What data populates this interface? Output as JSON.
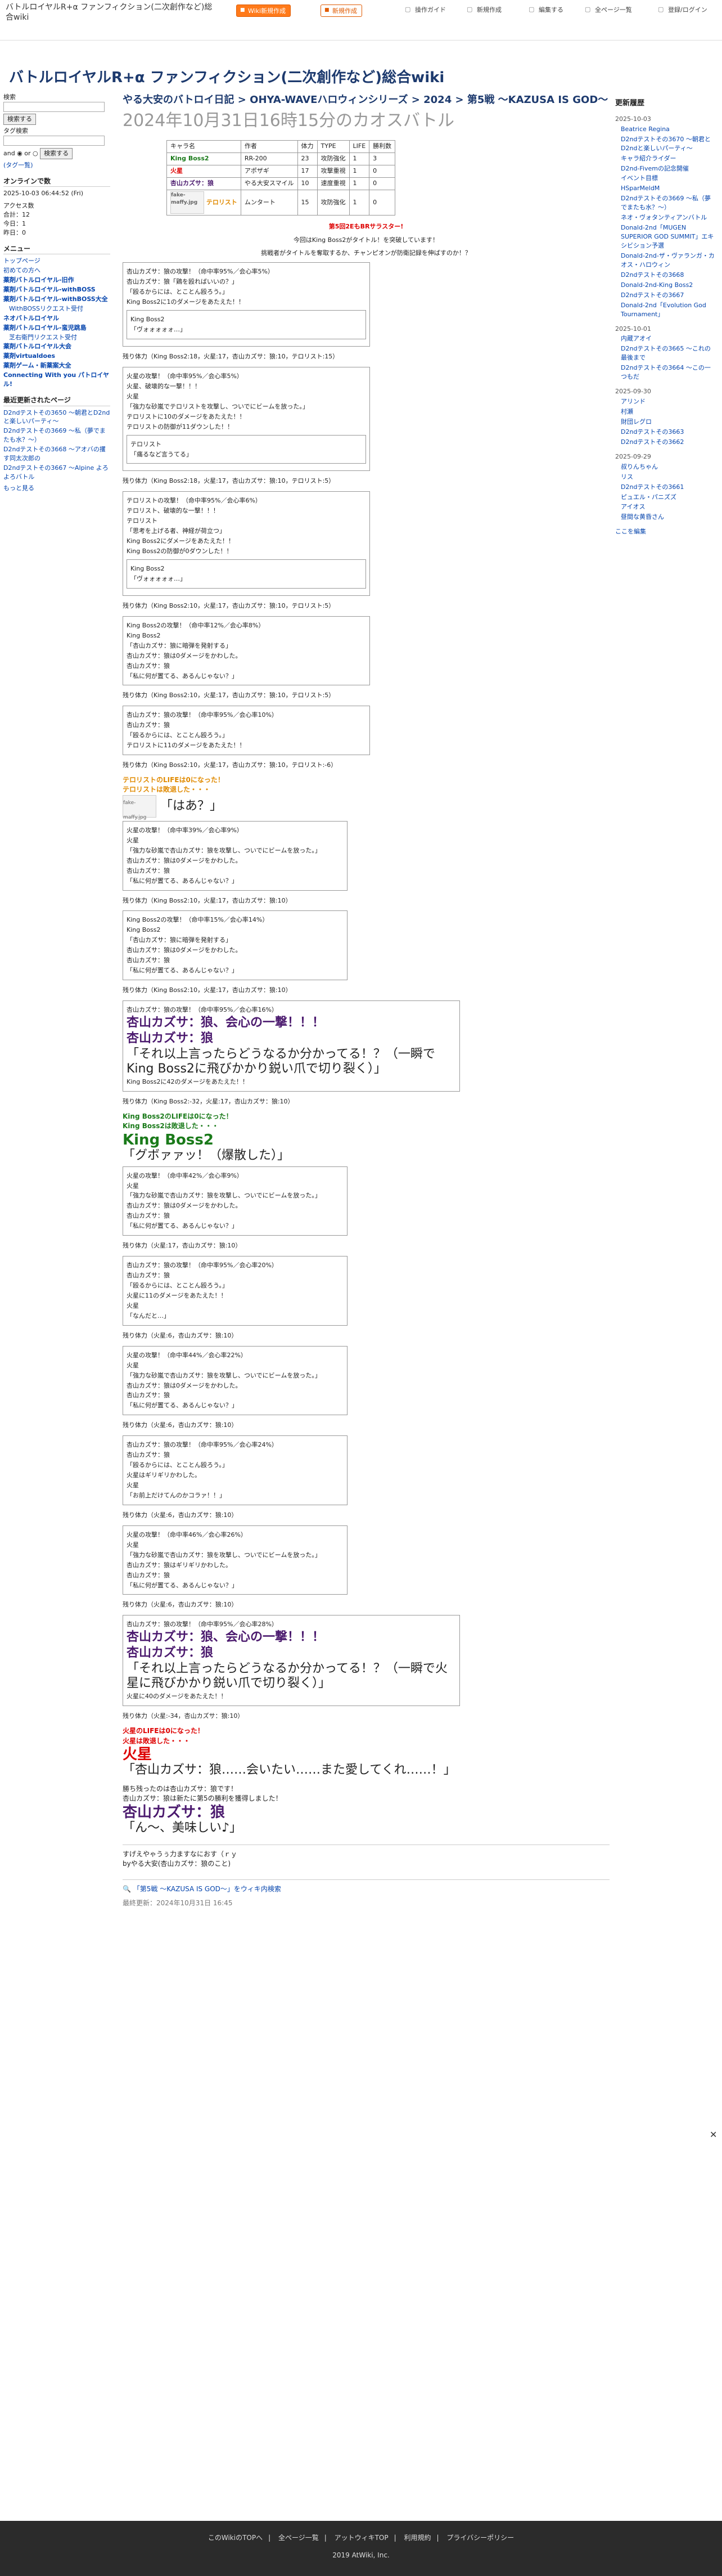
{
  "topbar": {
    "site_title": "バトルロイヤルR+α ファンフィクション(二次創作など)総合wiki",
    "btn_wiki": "Wiki新規作成",
    "btn_new_page": "新規作成",
    "btn_operations": "操作ガイド",
    "btn_new": "新規作成",
    "btn_edit": "編集する",
    "btn_all_pages": "全ページ一覧",
    "btn_login": "登録/ログイン"
  },
  "header": {
    "wiki_title": "バトルロイヤルR+α ファンフィクション(二次創作など)総合wiki"
  },
  "left": {
    "search_label": "検索",
    "search_button": "検索する",
    "tag_search_label": "タグ検索",
    "and_label": "and",
    "or_label": "or",
    "tag_search_button": "検索する",
    "tag_list_link": "(タグ一覧)",
    "online_label": "オンラインで数",
    "updated": "2025-10-03 06:44:52 (Fri)",
    "access_label": "アクセス数",
    "access_total": "合計：12",
    "access_today": "今日：1",
    "access_yesterday": "昨日：0",
    "menu_title": "メニュー",
    "menu": [
      "トップページ",
      "初めての方へ",
      "薬剤バトルロイヤル-旧作",
      "薬剤バトルロイヤル-withBOSS",
      "薬剤バトルロイヤル-withBOSS大全",
      "WithBOSSリクエスト受付",
      "ネオバトルロイヤル",
      "薬剤バトルロイヤル-蛮児跳島",
      "芝右衛門リクエスト受付",
      "薬剤バトルロイヤル大会",
      "薬剤virtualdoes",
      "薬剤ゲーム・新薬案大全",
      "Connecting With you パトロイヤル!"
    ],
    "recent_title": "最近更新されたページ",
    "recent": [
      "D2ndテストその3650 〜朝君とD2ndと楽しいパーティ〜",
      "D2ndテストその3669 〜私（夢でまたも水？〜）",
      "D2ndテストその3668 〜アオバの攫す同太次郎の",
      "D2ndテストその3667 〜Alpine よろよろバトル"
    ],
    "more_link": "もっと見る"
  },
  "main": {
    "breadcrumb": "やる大安のバトロイ日記 > OHYA-WAVEハロウィンシリーズ > 2024 > 第5戦 〜KAZUSA IS GOD〜",
    "page_title": "2024年10月31日16時15分のカオスバトル",
    "table_headers": [
      "キャラ名",
      "作者",
      "体力",
      "TYPE",
      "LIFE",
      "勝利数"
    ],
    "table_rows": [
      [
        "King Boss2",
        "RR-200",
        "23",
        "攻防強化",
        "1",
        "3"
      ],
      [
        "火星",
        "アポザギ",
        "17",
        "攻撃重視",
        "1",
        "0"
      ],
      [
        "杏山カズサ：狼",
        "やる大安スマイル",
        "10",
        "速度重視",
        "1",
        "0"
      ],
      [
        "テロリスト",
        "ムンタート",
        "15",
        "攻防強化",
        "1",
        "0"
      ]
    ],
    "image_alt": "fake-maffy.jpg",
    "announce_1": "第5回2EもBRサラスター!",
    "announce_2": "今回はKing Boss2がタイトル！を突破しています！",
    "announce_3": "挑戦者がタイトルを奪取するか、チャンピオンが防衛記録を伸ばすのか！？",
    "turns": [
      {
        "lines": [
          "杏山カズサ：狼の攻撃！（命中率95%／会心率5%）",
          "杏山カズサ：狼「鶏を殴ればいいの？」",
          "「殴るからには、とことん殴ろう。」",
          "King Boss2に1のダメージをあたえた！！"
        ],
        "sub": [
          "King Boss2",
          "「ヴォォォォォ…」"
        ],
        "status": "残り体力（King Boss2:18，火星:17，杏山カズサ：狼:10，テロリスト:15）"
      },
      {
        "lines": [
          "火星の攻撃！（命中率95%／会心率5%）",
          "火星、破壊的な一撃！！！",
          "火星",
          "「強力な砂嵐でテロリストを攻撃し、ついでにビームを放った。」",
          "テロリストに10のダメージをあたえた！！",
          "テロリストの防御が11ダウンした！！"
        ],
        "sub": [
          "テロリスト",
          "「痛るなど言うてる」"
        ],
        "status": "残り体力（King Boss2:18，火星:17，杏山カズサ：狼:10，テロリスト:5）"
      },
      {
        "lines": [
          "テロリストの攻撃！（命中率95%／会心率6%）",
          "テロリスト、破壊的な一撃！！！",
          "テロリスト",
          "「思考を上げる者、神経が荷立つ」",
          "King Boss2にダメージをあたえた！！",
          "King Boss2の防御が0ダウンした！！"
        ],
        "sub": [
          "King Boss2",
          "「ヴォォォォォ…」"
        ],
        "status": "残り体力（King Boss2:10，火星:17，杏山カズサ：狼:10，テロリスト:5）"
      },
      {
        "lines": [
          "King Boss2の攻撃！（命中率12%／会心率8%）",
          "King Boss2",
          "「杏山カズサ：狼に暗弾を発射する」",
          "杏山カズサ：狼は0ダメージをかわした。",
          "杏山カズサ：狼",
          "「私に何が置てる、あるんじゃない？」"
        ],
        "sub": [],
        "status": "残り体力（King Boss2:10，火星:17，杏山カズサ：狼:10，テロリスト:5）"
      },
      {
        "lines": [
          "杏山カズサ：狼の攻撃！（命中率95%／会心率10%）",
          "杏山カズサ：狼",
          "「殴るからには、とことん殴ろう。」",
          "テロリストに11のダメージをあたえた！！"
        ],
        "sub": [],
        "status": "残り体力（King Boss2:10，火星:17，杏山カズサ：狼:10，テロリスト:-6）"
      }
    ],
    "defeat_terrorist_1": "テロリストのLIFEは0になった！",
    "defeat_terrorist_2": "テロリストは敗退した・・・",
    "defeat_terrorist_quote": "「はあ？」",
    "turns2": [
      {
        "lines": [
          "火星の攻撃！（命中率39%／会心率9%）",
          "火星",
          "「強力な砂嵐で杏山カズサ：狼を攻撃し、ついでにビームを放った。」",
          "杏山カズサ：狼は0ダメージをかわした。",
          "杏山カズサ：狼",
          "「私に何が置てる、あるんじゃない？」"
        ],
        "status": "残り体力（King Boss2:10，火星:17，杏山カズサ：狼:10）"
      },
      {
        "lines": [
          "King Boss2の攻撃！（命中率15%／会心率14%）",
          "King Boss2",
          "「杏山カズサ：狼に暗弾を発射する」",
          "杏山カズサ：狼は0ダメージをかわした。",
          "杏山カズサ：狼",
          "「私に何が置てる、あるんじゃない？」"
        ],
        "status": "残り体力（King Boss2:10，火星:17，杏山カズサ：狼:10）"
      }
    ],
    "critical_1": {
      "lines": [
        "杏山カズサ：狼の攻撃！（命中率95%／会心率16%）",
        "杏山カズサ：狼、会心の一撃！！！",
        "杏山カズサ：狼",
        "「それ以上言ったらどうなるか分かってる！？（一瞬でKing Boss2に飛びかかり鋭い爪で切り裂く）」",
        "King Boss2に42のダメージをあたえた！！"
      ],
      "status": "残り体力（King Boss2:-32，火星:17，杏山カズサ：狼:10）"
    },
    "defeat_kb_1": "King Boss2のLIFEは0になった！",
    "defeat_kb_2": "King Boss2は敗退した・・・",
    "defeat_kb_name": "King Boss2",
    "defeat_kb_quote": "「グボァァッ！（爆散した）」",
    "turns3": [
      {
        "lines": [
          "火星の攻撃！（命中率42%／会心率9%）",
          "火星",
          "「強力な砂嵐で杏山カズサ：狼を攻撃し、ついでにビームを放った。」",
          "杏山カズサ：狼は0ダメージをかわした。",
          "杏山カズサ：狼",
          "「私に何が置てる、あるんじゃない？」"
        ],
        "status": "残り体力（火星:17，杏山カズサ：狼:10）"
      },
      {
        "lines": [
          "杏山カズサ：狼の攻撃！（命中率95%／会心率20%）",
          "杏山カズサ：狼",
          "「殴るからには、とことん殴ろう。」",
          "火星に11のダメージをあたえた！！",
          "火星",
          "「なんだと…」"
        ],
        "status": "残り体力（火星:6，杏山カズサ：狼:10）"
      },
      {
        "lines": [
          "火星の攻撃！（命中率44%／会心率22%）",
          "火星",
          "「強力な砂嵐で杏山カズサ：狼を攻撃し、ついでにビームを放った。」",
          "杏山カズサ：狼は0ダメージをかわした。",
          "杏山カズサ：狼",
          "「私に何が置てる、あるんじゃない？」"
        ],
        "status": "残り体力（火星:6，杏山カズサ：狼:10）"
      },
      {
        "lines": [
          "杏山カズサ：狼の攻撃！（命中率95%／会心率24%）",
          "杏山カズサ：狼",
          "「殴るからには、とことん殴ろう。」",
          "火星はギリギリかわした。",
          "火星",
          "「お前上だけてんのかコラァ！！」"
        ],
        "status": "残り体力（火星:6，杏山カズサ：狼:10）"
      },
      {
        "lines": [
          "火星の攻撃！（命中率46%／会心率26%）",
          "火星",
          "「強力な砂嵐で杏山カズサ：狼を攻撃し、ついでにビームを放った。」",
          "杏山カズサ：狼はギリギリかわした。",
          "杏山カズサ：狼",
          "「私に何が置てる、あるんじゃない？」"
        ],
        "status": "残り体力（火星:6，杏山カズサ：狼:10）"
      }
    ],
    "critical_2": {
      "lines": [
        "杏山カズサ：狼の攻撃！（命中率95%／会心率28%）",
        "杏山カズサ：狼、会心の一撃！！！",
        "杏山カズサ：狼",
        "「それ以上言ったらどうなるか分かってる！？（一瞬で火星に飛びかかり鋭い爪で切り裂く）」",
        "火星に40のダメージをあたえた！！"
      ],
      "status": "残り体力（火星:-34，杏山カズサ：狼:10）"
    },
    "defeat_mars_1": "火星のLIFEは0になった！",
    "defeat_mars_2": "火星は敗退した・・・",
    "defeat_mars_name": "火星",
    "defeat_mars_quote": "「杏山カズサ：狼……会いたい……また愛してくれ……！」",
    "winner_line": "勝ち残ったのは杏山カズサ：狼です！",
    "winner_sub": "杏山カズサ：狼は新たに第5の勝利を獲得しました！",
    "winner_name": "杏山カズサ：狼",
    "winner_quote": "「ん〜、美味しい♪」",
    "closing_1": "すげえやゃうぅ力ますなにおす（ｒｙ",
    "closing_2": "byやる大安(杏山カズサ：狼のこと)",
    "related_link": "「第5戦 〜KAZUSA IS GOD〜」をウィキ内検索",
    "last_updated": "最終更新：2024年10月31日 16:45"
  },
  "right": {
    "title": "更新履歴",
    "groups": [
      {
        "date": "2025-10-03",
        "items": [
          "Beatrice Regina",
          "D2ndテストその3670 〜朝君とD2ndと楽しいパーティ〜",
          "キャラ紹介ライダー",
          "D2nd-Fivemの記念開催",
          "イベント目標",
          "HSparMeldM",
          "D2ndテストその3669 〜私（夢でまたも水？〜）",
          "ネオ・ヴォタンティアンバトル",
          "Donald-2nd「MUGEN SUPERIOR GOD SUMMIT」エキシビション予選",
          "Donald-2nd-ザ・ヴァランガ・カオス・ハロウィン",
          "D2ndテストその3668",
          "Donald-2nd-King Boss2",
          "D2ndテストその3667",
          "Donald-2nd「Evolution God Tournament」"
        ]
      },
      {
        "date": "2025-10-01",
        "items": [
          "内蔵アオイ",
          "D2ndテストその3665 〜これの最後まで",
          "D2ndテストその3664 〜この一つもだ"
        ]
      },
      {
        "date": "2025-09-30",
        "items": [
          "アリンド",
          "村瀬",
          "財団レグロ",
          "D2ndテストその3663",
          "D2ndテストその3662"
        ]
      },
      {
        "date": "2025-09-29",
        "items": [
          "叔りんちゃん",
          "リス",
          "D2ndテストその3661",
          "ピュエル・パニズズ",
          "アイオス",
          "昼間な黄昏さん"
        ]
      }
    ],
    "edit_link": "ここを編集"
  },
  "footer": {
    "links": [
      "このWikiのTOPへ",
      "全ページ一覧",
      "アットウィキTOP",
      "利用規約",
      "プライバシーポリシー"
    ],
    "copyright": "2019 AtWiki, Inc."
  }
}
